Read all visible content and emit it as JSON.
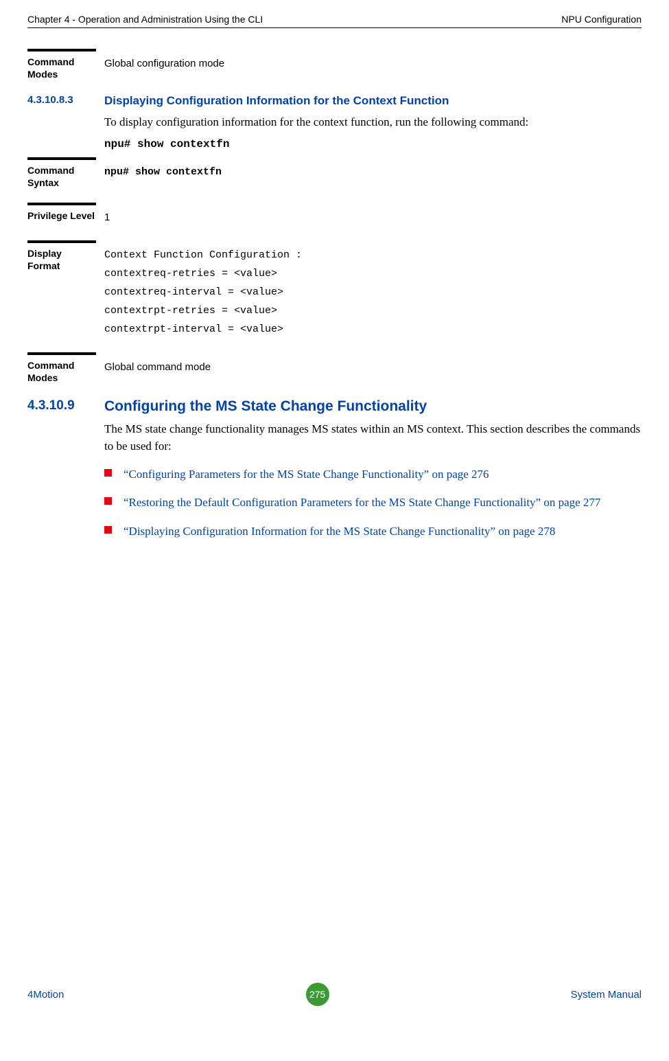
{
  "header": {
    "left": "Chapter 4 - Operation and Administration Using the CLI",
    "right": "NPU Configuration"
  },
  "entry1": {
    "label": "Command Modes",
    "value": "Global configuration mode"
  },
  "sec1": {
    "num": "4.3.10.8.3",
    "title": "Displaying Configuration Information for the Context Function",
    "body": "To display configuration information for the context function, run the following command:",
    "code": "npu# show contextfn"
  },
  "entry2": {
    "label": "Command Syntax",
    "value": "npu# show contextfn"
  },
  "entry3": {
    "label": "Privilege Level",
    "value": "1"
  },
  "entry4": {
    "label": "Display Format",
    "line1": "Context Function Configuration :",
    "line2": "contextreq-retries = <value>",
    "line3": "contextreq-interval = <value>",
    "line4": "contextrpt-retries = <value>",
    "line5": "contextrpt-interval = <value>"
  },
  "entry5": {
    "label": "Command Modes",
    "value": "Global command mode"
  },
  "sec2": {
    "num": "4.3.10.9",
    "title": "Configuring the MS State Change Functionality",
    "body": "The MS state change functionality manages MS states within an MS context. This section describes the commands to be used for:",
    "bullets": {
      "b1": "“Configuring Parameters for the MS State Change Functionality” on page 276",
      "b2": "“Restoring the Default Configuration Parameters for the MS State Change Functionality” on page 277",
      "b3": "“Displaying Configuration Information for the MS State Change Functionality” on page 278"
    }
  },
  "footer": {
    "left": "4Motion",
    "center": "275",
    "right": "System Manual"
  }
}
